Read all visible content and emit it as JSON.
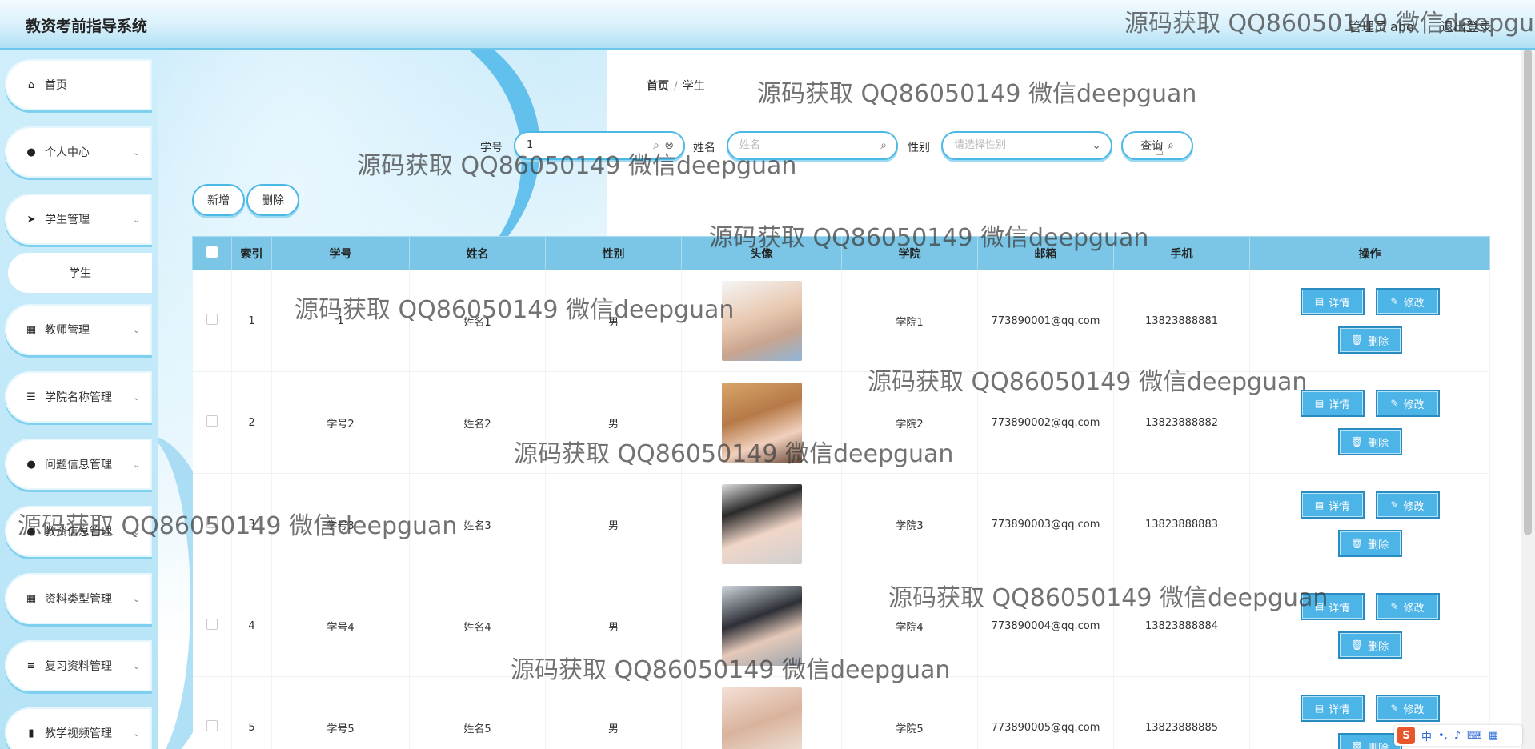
{
  "header": {
    "app_title": "教资考前指导系统",
    "user_role": "管理员",
    "user_name": "abo",
    "logout_label": "退出登录"
  },
  "sidebar": {
    "items": [
      {
        "label": "首页",
        "icon": "home-icon",
        "has_children": false
      },
      {
        "label": "个人中心",
        "icon": "user-icon",
        "has_children": true
      },
      {
        "label": "学生管理",
        "icon": "send-icon",
        "has_children": true
      },
      {
        "label": "教师管理",
        "icon": "grid-icon",
        "has_children": true
      },
      {
        "label": "学院名称管理",
        "icon": "sliders-icon",
        "has_children": true
      },
      {
        "label": "问题信息管理",
        "icon": "user-icon",
        "has_children": true
      },
      {
        "label": "教资信息管理",
        "icon": "user-icon",
        "has_children": true
      },
      {
        "label": "资料类型管理",
        "icon": "grid-icon",
        "has_children": true
      },
      {
        "label": "复习资料管理",
        "icon": "list-icon",
        "has_children": true
      },
      {
        "label": "教学视频管理",
        "icon": "bar-chart-icon",
        "has_children": true
      }
    ],
    "active_submenu": "学生"
  },
  "breadcrumb": {
    "home": "首页",
    "separator": "/",
    "current": "学生"
  },
  "search": {
    "student_id_label": "学号",
    "student_id_value": "1",
    "name_label": "姓名",
    "name_placeholder": "姓名",
    "gender_label": "性别",
    "gender_placeholder": "请选择性别",
    "query_label": "查询"
  },
  "actions": {
    "add_label": "新增",
    "delete_label": "删除"
  },
  "table": {
    "columns": [
      "索引",
      "学号",
      "姓名",
      "性别",
      "头像",
      "学院",
      "邮箱",
      "手机",
      "操作"
    ],
    "rows": [
      {
        "index": "1",
        "student_id": "1",
        "name": "姓名1",
        "gender": "男",
        "college": "学院1",
        "email": "773890001@qq.com",
        "phone": "13823888881"
      },
      {
        "index": "2",
        "student_id": "学号2",
        "name": "姓名2",
        "gender": "男",
        "college": "学院2",
        "email": "773890002@qq.com",
        "phone": "13823888882"
      },
      {
        "index": "3",
        "student_id": "学号3",
        "name": "姓名3",
        "gender": "男",
        "college": "学院3",
        "email": "773890003@qq.com",
        "phone": "13823888883"
      },
      {
        "index": "4",
        "student_id": "学号4",
        "name": "姓名4",
        "gender": "男",
        "college": "学院4",
        "email": "773890004@qq.com",
        "phone": "13823888884"
      },
      {
        "index": "5",
        "student_id": "学号5",
        "name": "姓名5",
        "gender": "男",
        "college": "学院5",
        "email": "773890005@qq.com",
        "phone": "13823888885"
      }
    ],
    "op_labels": {
      "detail": "详情",
      "edit": "修改",
      "delete": "删除"
    }
  },
  "watermark": "源码获取 QQ86050149 微信deepguan",
  "watermark_top": "源码获取 QQ86050149 微信deepgua",
  "ime": {
    "logo": "S",
    "lang": "中"
  },
  "colors": {
    "accent": "#4db4e8",
    "table_header": "#7bc6e6",
    "border": "#4cb8e5"
  }
}
